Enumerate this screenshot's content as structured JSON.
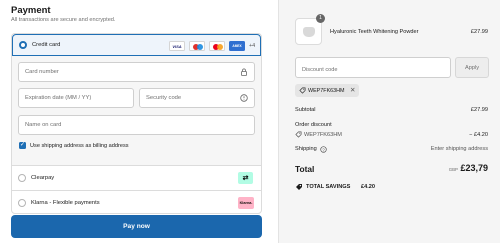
{
  "payment": {
    "title": "Payment",
    "subtitle": "All transactions are secure and encrypted.",
    "credit_card": {
      "label": "Credit card",
      "selected": true,
      "card_logos": [
        "VISA",
        "Maestro",
        "Mastercard",
        "AMEX"
      ],
      "more_cards": "+4",
      "fields": {
        "card_number": {
          "placeholder": "Card number",
          "icon": "lock-icon"
        },
        "expiration": {
          "placeholder": "Expiration date (MM / YY)"
        },
        "security_code": {
          "placeholder": "Security code",
          "icon": "help-icon"
        },
        "name_on_card": {
          "placeholder": "Name on card"
        }
      },
      "billing_checkbox": {
        "label": "Use shipping address as billing address",
        "checked": true
      }
    },
    "alternatives": [
      {
        "label": "Clearpay",
        "badge": "clearpay-logo"
      },
      {
        "label": "Klarna - Flexible payments",
        "badge": "Klarna."
      }
    ],
    "pay_button": "Pay now"
  },
  "summary": {
    "item": {
      "quantity": "1",
      "name": "Hyaluronic Teeth Whitening Powder",
      "price": "£27.99"
    },
    "discount": {
      "placeholder": "Discount code",
      "apply_label": "Apply",
      "applied_code": "WEP7FK63HM"
    },
    "subtotal": {
      "label": "Subtotal",
      "value": "£27.99"
    },
    "order_discount": {
      "label": "Order discount",
      "code": "WEP7FK63HM",
      "value": "− £4.20"
    },
    "shipping": {
      "label": "Shipping",
      "value": "Enter shipping address"
    },
    "total": {
      "label": "Total",
      "currency": "GBP",
      "value": "£23,79"
    },
    "savings": {
      "label": "TOTAL SAVINGS",
      "value": "£4.20"
    }
  },
  "colors": {
    "accent": "#1b67ad",
    "clearpay": "#b2fce4",
    "klarna": "#ffb3c7"
  }
}
